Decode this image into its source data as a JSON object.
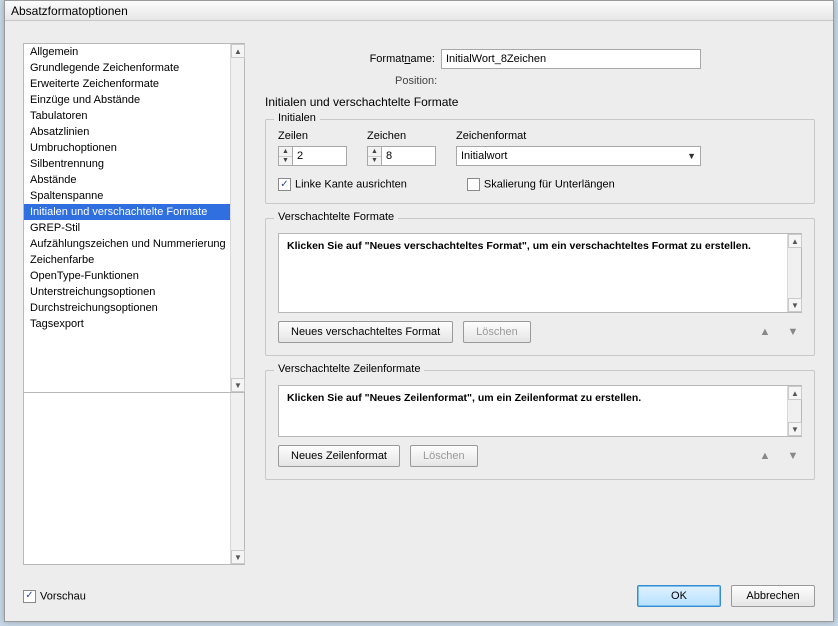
{
  "window": {
    "title": "Absatzformatoptionen"
  },
  "sidebar": {
    "items": [
      "Allgemein",
      "Grundlegende Zeichenformate",
      "Erweiterte Zeichenformate",
      "Einzüge und Abstände",
      "Tabulatoren",
      "Absatzlinien",
      "Umbruchoptionen",
      "Silbentrennung",
      "Abstände",
      "Spaltenspanne",
      "Initialen und verschachtelte Formate",
      "GREP-Stil",
      "Aufzählungszeichen und Nummerierung",
      "Zeichenfarbe",
      "OpenType-Funktionen",
      "Unterstreichungsoptionen",
      "Durchstreichungsoptionen",
      "Tagsexport"
    ],
    "selectedIndex": 10
  },
  "header": {
    "formatname_label": "Formatname:",
    "formatname_value": "InitialWort_8Zeichen",
    "position_label": "Position:",
    "section_title": "Initialen und verschachtelte Formate"
  },
  "initialen": {
    "legend": "Initialen",
    "zeilen_label": "Zeilen",
    "zeilen_value": "2",
    "zeichen_label": "Zeichen",
    "zeichen_value": "8",
    "zeichenformat_label": "Zeichenformat",
    "zeichenformat_value": "Initialwort",
    "cb_linke_kante": "Linke Kante ausrichten",
    "cb_linke_kante_checked": true,
    "cb_skalierung": "Skalierung für Unterlängen",
    "cb_skalierung_checked": false
  },
  "nested": {
    "legend": "Verschachtelte Formate",
    "hint": "Klicken Sie auf \"Neues verschachteltes Format\", um ein verschachteltes Format zu erstellen.",
    "btn_new": "Neues verschachteltes Format",
    "btn_delete": "Löschen"
  },
  "lineformats": {
    "legend": "Verschachtelte Zeilenformate",
    "hint": "Klicken Sie auf \"Neues Zeilenformat\", um ein Zeilenformat zu erstellen.",
    "btn_new": "Neues Zeilenformat",
    "btn_delete": "Löschen"
  },
  "footer": {
    "preview_label": "Vorschau",
    "preview_checked": true,
    "ok": "OK",
    "cancel": "Abbrechen"
  }
}
